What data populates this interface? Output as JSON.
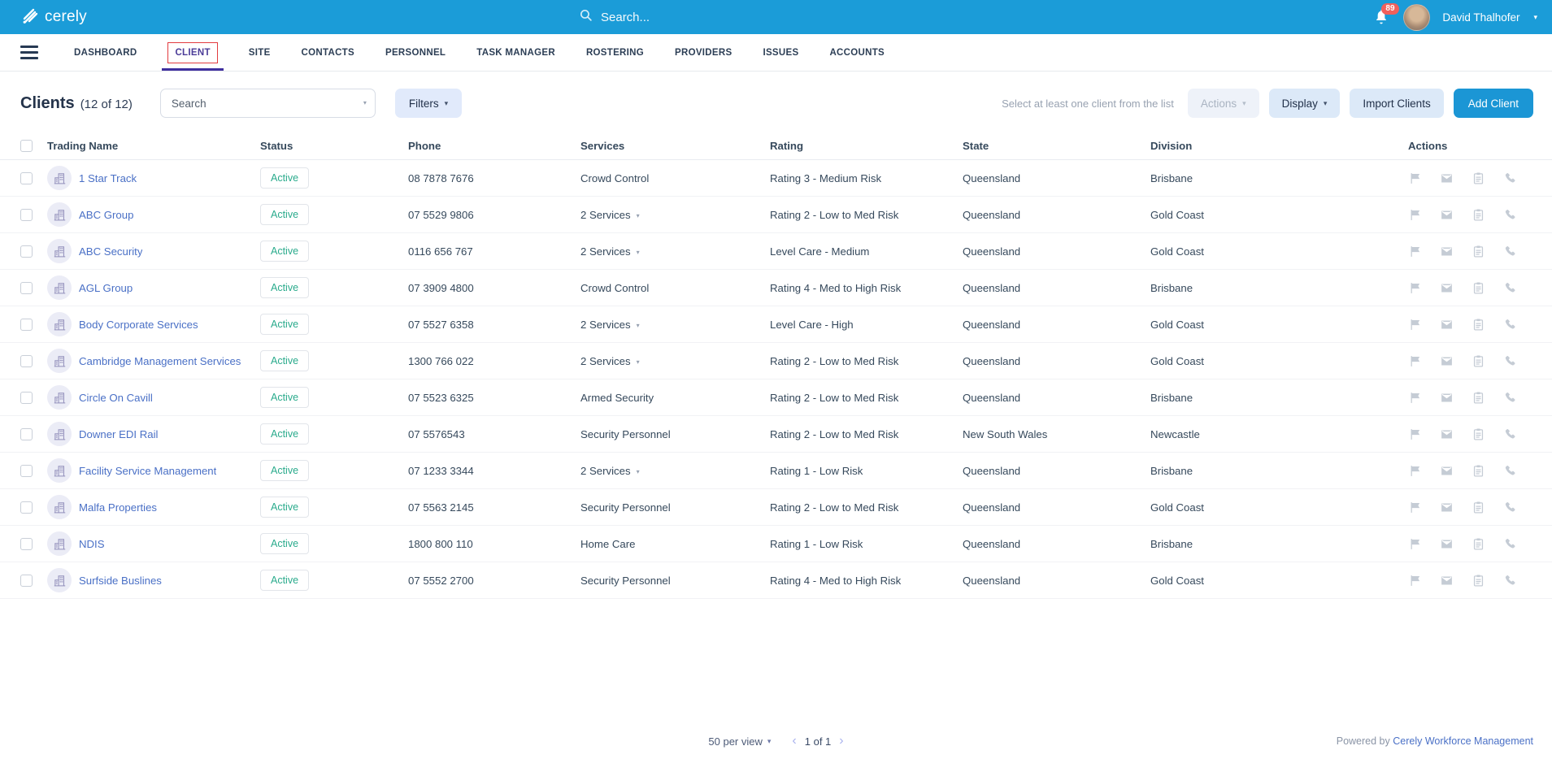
{
  "topbar": {
    "brand": "cerely",
    "search_placeholder": "Search...",
    "notification_count": "89",
    "user_name": "David Thalhofer"
  },
  "nav": {
    "items": [
      {
        "label": "DASHBOARD"
      },
      {
        "label": "CLIENT",
        "active": true
      },
      {
        "label": "SITE"
      },
      {
        "label": "CONTACTS"
      },
      {
        "label": "PERSONNEL"
      },
      {
        "label": "TASK MANAGER"
      },
      {
        "label": "ROSTERING"
      },
      {
        "label": "PROVIDERS"
      },
      {
        "label": "ISSUES"
      },
      {
        "label": "ACCOUNTS"
      }
    ]
  },
  "header": {
    "title": "Clients",
    "count": "(12 of 12)",
    "search_placeholder": "Search",
    "filters_label": "Filters",
    "hint": "Select at least one client from the list",
    "actions_label": "Actions",
    "display_label": "Display",
    "import_label": "Import Clients",
    "add_label": "Add Client"
  },
  "table": {
    "columns": [
      "Trading Name",
      "Status",
      "Phone",
      "Services",
      "Rating",
      "State",
      "Division",
      "Actions"
    ],
    "row_action_icons": [
      "flag-icon",
      "mail-icon",
      "clipboard-icon",
      "phone-icon"
    ],
    "rows": [
      {
        "name": "1 Star Track",
        "status": "Active",
        "phone": "08 7878 7676",
        "services": "Crowd Control",
        "services_dropdown": false,
        "rating": "Rating 3 - Medium Risk",
        "state": "Queensland",
        "division": "Brisbane"
      },
      {
        "name": "ABC Group",
        "status": "Active",
        "phone": "07 5529 9806",
        "services": "2 Services",
        "services_dropdown": true,
        "rating": "Rating 2 - Low to Med Risk",
        "state": "Queensland",
        "division": "Gold Coast"
      },
      {
        "name": "ABC Security",
        "status": "Active",
        "phone": "0116 656 767",
        "services": "2 Services",
        "services_dropdown": true,
        "rating": "Level Care - Medium",
        "state": "Queensland",
        "division": "Gold Coast"
      },
      {
        "name": "AGL Group",
        "status": "Active",
        "phone": "07 3909 4800",
        "services": "Crowd Control",
        "services_dropdown": false,
        "rating": "Rating 4 - Med to High Risk",
        "state": "Queensland",
        "division": "Brisbane"
      },
      {
        "name": "Body Corporate Services",
        "status": "Active",
        "phone": "07 5527 6358",
        "services": "2 Services",
        "services_dropdown": true,
        "rating": "Level Care - High",
        "state": "Queensland",
        "division": "Gold Coast"
      },
      {
        "name": "Cambridge Management Services",
        "status": "Active",
        "phone": "1300 766 022",
        "services": "2 Services",
        "services_dropdown": true,
        "rating": "Rating 2 - Low to Med Risk",
        "state": "Queensland",
        "division": "Gold Coast"
      },
      {
        "name": "Circle On Cavill",
        "status": "Active",
        "phone": "07 5523 6325",
        "services": "Armed Security",
        "services_dropdown": false,
        "rating": "Rating 2 - Low to Med Risk",
        "state": "Queensland",
        "division": "Brisbane"
      },
      {
        "name": "Downer EDI Rail",
        "status": "Active",
        "phone": "07 5576543",
        "services": "Security Personnel",
        "services_dropdown": false,
        "rating": "Rating 2 - Low to Med Risk",
        "state": "New South Wales",
        "division": "Newcastle"
      },
      {
        "name": "Facility Service Management",
        "status": "Active",
        "phone": "07 1233 3344",
        "services": "2 Services",
        "services_dropdown": true,
        "rating": "Rating 1 - Low Risk",
        "state": "Queensland",
        "division": "Brisbane"
      },
      {
        "name": "Malfa Properties",
        "status": "Active",
        "phone": "07 5563 2145",
        "services": "Security Personnel",
        "services_dropdown": false,
        "rating": "Rating 2 - Low to Med Risk",
        "state": "Queensland",
        "division": "Gold Coast"
      },
      {
        "name": "NDIS",
        "status": "Active",
        "phone": "1800 800 110",
        "services": "Home Care",
        "services_dropdown": false,
        "rating": "Rating 1 - Low Risk",
        "state": "Queensland",
        "division": "Brisbane"
      },
      {
        "name": "Surfside Buslines",
        "status": "Active",
        "phone": "07 5552 2700",
        "services": "Security Personnel",
        "services_dropdown": false,
        "rating": "Rating 4 - Med to High Risk",
        "state": "Queensland",
        "division": "Gold Coast"
      }
    ]
  },
  "footer": {
    "per_view": "50 per view",
    "page_info": "1 of 1",
    "powered_by": "Powered by",
    "powered_link": "Cerely Workforce Management"
  },
  "colors": {
    "topbar_blue": "#1b9cd8",
    "primary_button_blue": "#1b96d5",
    "active_tab_purple": "#4b3c98",
    "active_tab_underline": "#3f2f9e",
    "highlight_red_outline": "#e23b3f",
    "link_blue": "#4a70c6",
    "status_active_green": "#2aab8c",
    "notification_red": "#f2605c"
  }
}
